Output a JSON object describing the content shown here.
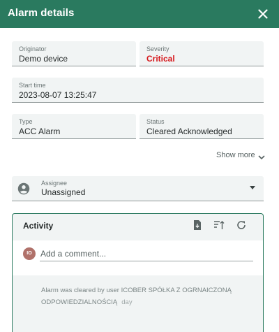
{
  "dialog": {
    "title": "Alarm details"
  },
  "fields": {
    "originator": {
      "label": "Originator",
      "value": "Demo device"
    },
    "severity": {
      "label": "Severity",
      "value": "Critical"
    },
    "start_time": {
      "label": "Start time",
      "value": "2023-08-07 13:25:47"
    },
    "type": {
      "label": "Type",
      "value": "ACC Alarm"
    },
    "status": {
      "label": "Status",
      "value": "Cleared Acknowledged"
    }
  },
  "show_more": {
    "label": "Show more"
  },
  "assignee": {
    "label": "Assignee",
    "value": "Unassigned"
  },
  "activity": {
    "title": "Activity",
    "avatar_initials": "IO",
    "comment_placeholder": "Add a comment...",
    "entries": [
      {
        "text": "Alarm was cleared by user ICOBER SPÓŁKA Z OGRNAICZONĄ ODPOWIEDZIALNOŚCIĄ",
        "time": "day"
      }
    ]
  },
  "colors": {
    "header": "#2a7a5f",
    "critical": "#d6171b",
    "field_bg": "#f1f4f4",
    "avatar": "#b0716a"
  },
  "icons": {
    "close": "close-icon",
    "chevron": "chevron-down-icon",
    "person": "account-circle-icon",
    "dropdown": "arrow-drop-down-icon",
    "export": "file-export-icon",
    "sort": "sort-icon",
    "refresh": "refresh-icon"
  }
}
